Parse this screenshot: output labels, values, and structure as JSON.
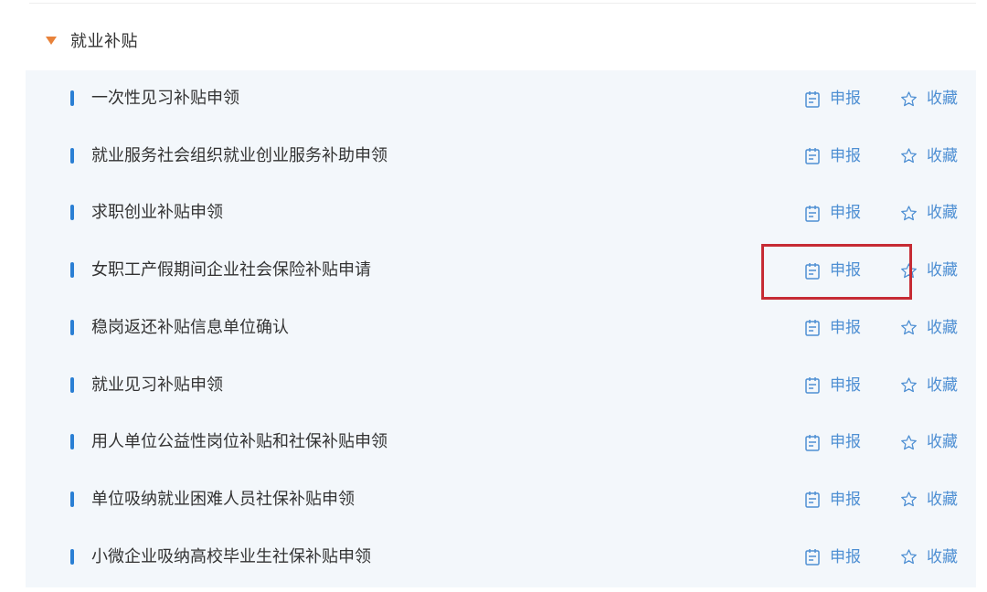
{
  "category": {
    "title": "就业补贴",
    "caret_icon": "caret-down-icon",
    "caret_color": "#e8823a"
  },
  "actions": {
    "declare_label": "申报",
    "declare_icon": "form-icon",
    "favorite_label": "收藏",
    "favorite_icon": "star-outline-icon",
    "link_color": "#4e8fd3"
  },
  "items": [
    {
      "label": "一次性见习补贴申领"
    },
    {
      "label": "就业服务社会组织就业创业服务补助申领"
    },
    {
      "label": "求职创业补贴申领"
    },
    {
      "label": "女职工产假期间企业社会保险补贴申请"
    },
    {
      "label": "稳岗返还补贴信息单位确认"
    },
    {
      "label": "就业见习补贴申领"
    },
    {
      "label": "用人单位公益性岗位补贴和社保补贴申领"
    },
    {
      "label": "单位吸纳就业困难人员社保补贴申领"
    },
    {
      "label": "小微企业吸纳高校毕业生社保补贴申领"
    }
  ],
  "highlight": {
    "color": "#c62b34",
    "target": "女职工产假期间企业社会保险补贴申请 — 申报"
  }
}
